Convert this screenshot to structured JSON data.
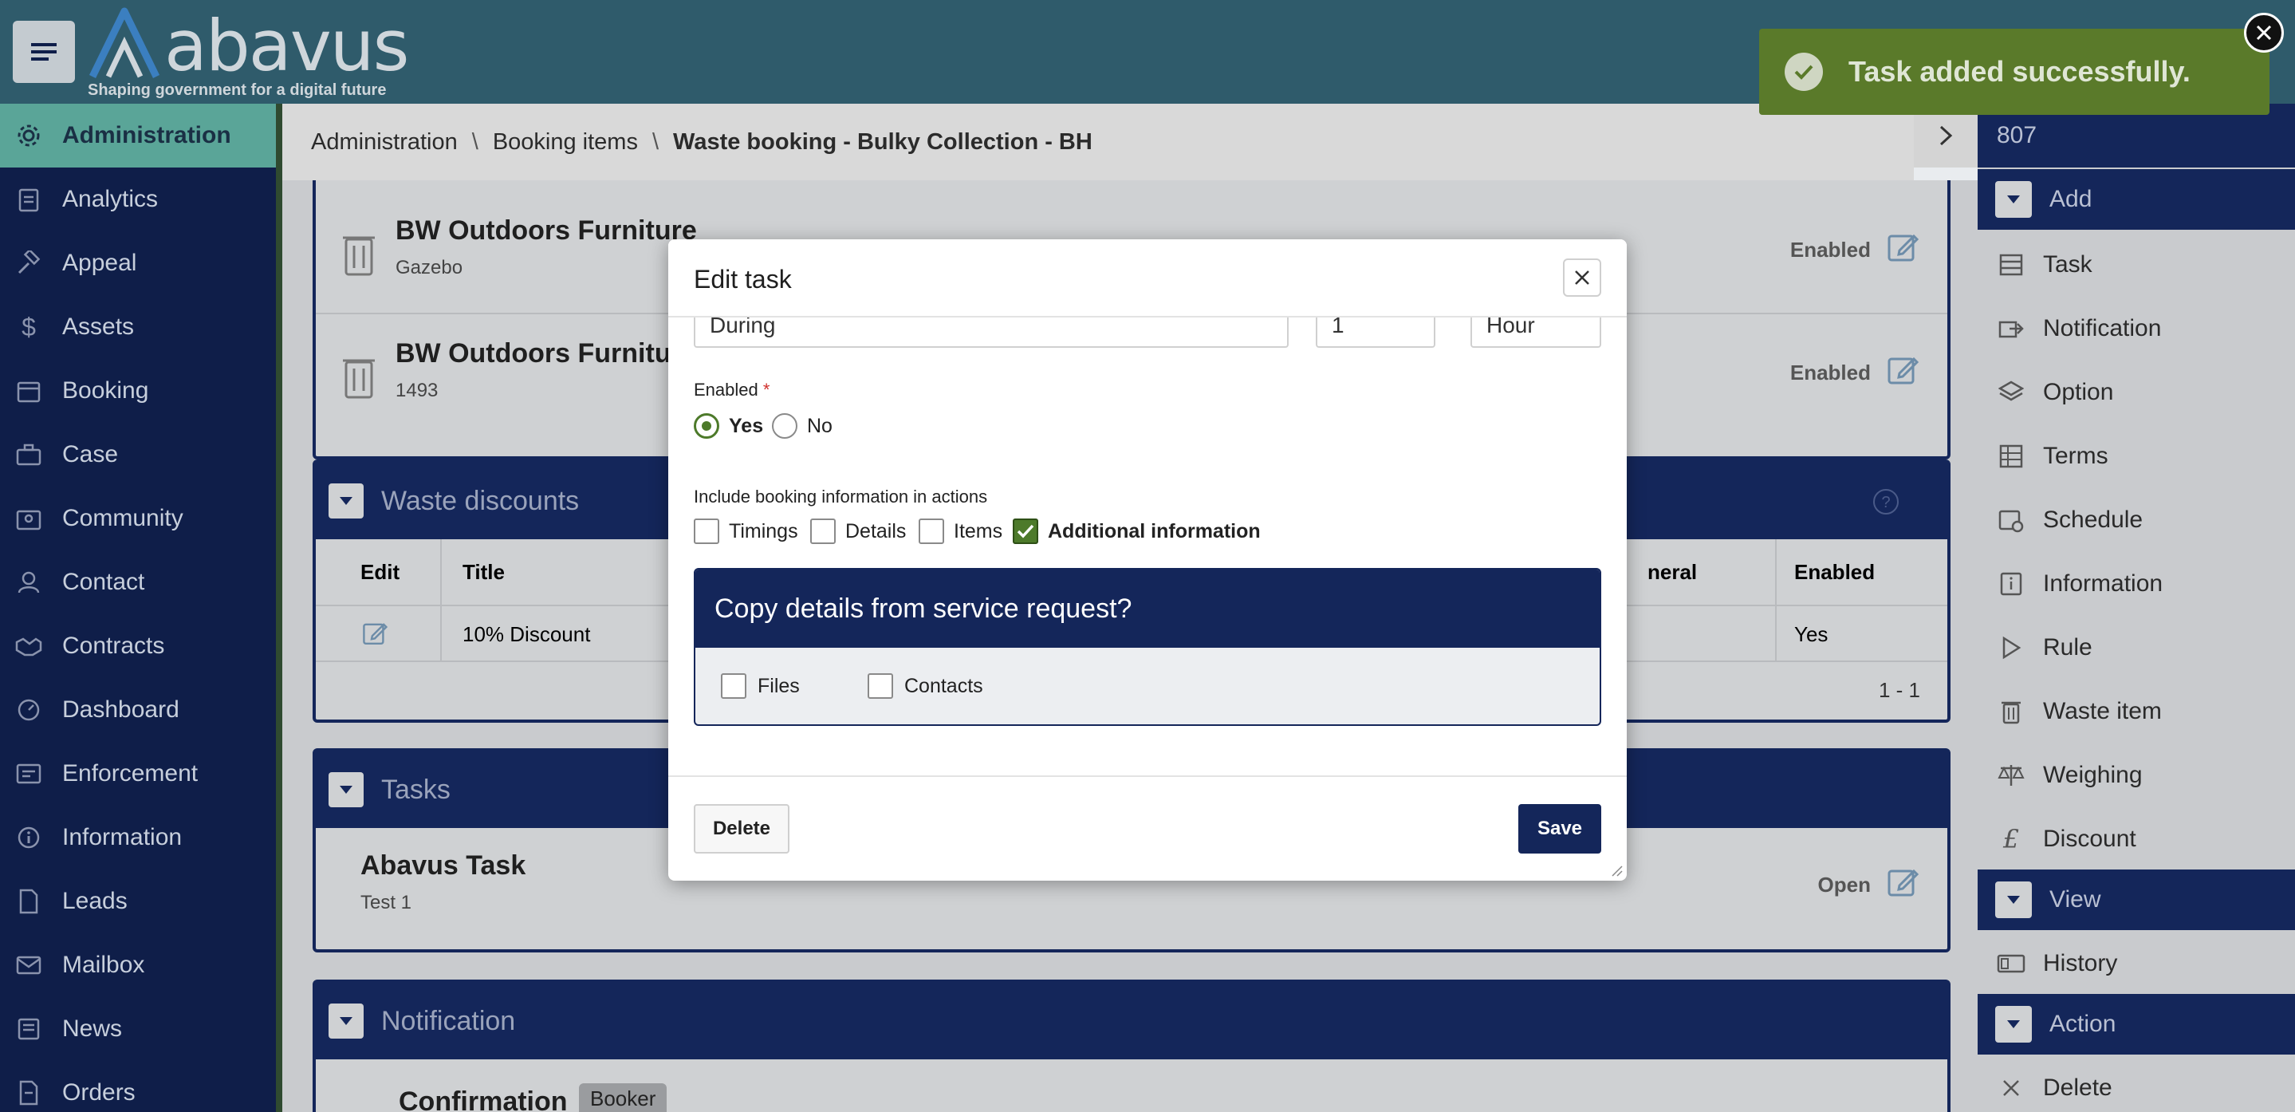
{
  "header": {
    "brand": "abavus",
    "tagline": "Shaping government for a digital future"
  },
  "sidebar": {
    "items": [
      {
        "label": "Administration",
        "icon": "gear-icon",
        "active": true
      },
      {
        "label": "Analytics",
        "icon": "clipboard-icon"
      },
      {
        "label": "Appeal",
        "icon": "gavel-icon"
      },
      {
        "label": "Assets",
        "icon": "dollar-icon"
      },
      {
        "label": "Booking",
        "icon": "calendar-icon"
      },
      {
        "label": "Case",
        "icon": "briefcase-icon"
      },
      {
        "label": "Community",
        "icon": "community-icon"
      },
      {
        "label": "Contact",
        "icon": "person-icon"
      },
      {
        "label": "Contracts",
        "icon": "handshake-icon"
      },
      {
        "label": "Dashboard",
        "icon": "gauge-icon"
      },
      {
        "label": "Enforcement",
        "icon": "enforcement-icon"
      },
      {
        "label": "Information",
        "icon": "info-icon"
      },
      {
        "label": "Leads",
        "icon": "document-icon"
      },
      {
        "label": "Mailbox",
        "icon": "mail-icon"
      },
      {
        "label": "News",
        "icon": "news-icon"
      },
      {
        "label": "Orders",
        "icon": "orders-icon"
      }
    ]
  },
  "breadcrumb": {
    "items": [
      "Administration",
      "Booking items"
    ],
    "current": "Waste booking - Bulky Collection - BH",
    "separator": "\\"
  },
  "main": {
    "waste_items": [
      {
        "title": "BW Outdoors Furniture",
        "sub": "Gazebo",
        "status": "Enabled"
      },
      {
        "title": "BW Outdoors Furniture",
        "sub": "1493",
        "status": "Enabled"
      }
    ],
    "discounts": {
      "title": "Waste discounts",
      "columns": [
        "Edit",
        "Title",
        "neral",
        "Enabled"
      ],
      "rows": [
        [
          "",
          "10% Discount",
          "",
          "Yes"
        ]
      ],
      "pager": "1 - 1"
    },
    "tasks": {
      "title": "Tasks",
      "items": [
        {
          "title": "Abavus Task",
          "sub": "Test 1",
          "status": "Open"
        }
      ]
    },
    "notification": {
      "title": "Notification",
      "items": [
        {
          "title": "Confirmation",
          "badge": "Booker"
        }
      ]
    }
  },
  "right_panel": {
    "id": "807",
    "sections": [
      {
        "title": "Add",
        "items": [
          {
            "label": "Task",
            "icon": "task-icon"
          },
          {
            "label": "Notification",
            "icon": "share-icon"
          },
          {
            "label": "Option",
            "icon": "layers-icon"
          },
          {
            "label": "Terms",
            "icon": "grid-icon"
          },
          {
            "label": "Schedule",
            "icon": "calendar-clock-icon"
          },
          {
            "label": "Information",
            "icon": "info-icon"
          },
          {
            "label": "Rule",
            "icon": "play-icon"
          },
          {
            "label": "Waste item",
            "icon": "trash-icon"
          },
          {
            "label": "Weighing",
            "icon": "scale-icon"
          },
          {
            "label": "Discount",
            "icon": "pound-icon"
          }
        ]
      },
      {
        "title": "View",
        "items": [
          {
            "label": "History",
            "icon": "history-icon"
          }
        ]
      },
      {
        "title": "Action",
        "items": [
          {
            "label": "Delete",
            "icon": "x-icon"
          }
        ]
      }
    ]
  },
  "toast": {
    "message": "Task added successfully.",
    "color": "#5a7a2a"
  },
  "modal": {
    "title": "Edit task",
    "fields": {
      "when_value": "During",
      "count_value": "1",
      "unit_value": "Hour"
    },
    "enabled_label": "Enabled",
    "required_mark": "*",
    "enabled_options": [
      {
        "label": "Yes",
        "selected": true
      },
      {
        "label": "No",
        "selected": false
      }
    ],
    "include_label": "Include booking information in actions",
    "include_options": [
      {
        "label": "Timings",
        "checked": false
      },
      {
        "label": "Details",
        "checked": false
      },
      {
        "label": "Items",
        "checked": false
      },
      {
        "label": "Additional information",
        "checked": true
      }
    ],
    "copy_section": {
      "title": "Copy details from service request?",
      "options": [
        {
          "label": "Files",
          "checked": false
        },
        {
          "label": "Contacts",
          "checked": false
        }
      ]
    },
    "delete_label": "Delete",
    "save_label": "Save"
  },
  "colors": {
    "navy": "#14265a",
    "sidebar_bg": "#0f1e49",
    "active_teal": "#5aa598",
    "header_bg": "#2f5b6b",
    "check_green": "#4d7a2a"
  }
}
